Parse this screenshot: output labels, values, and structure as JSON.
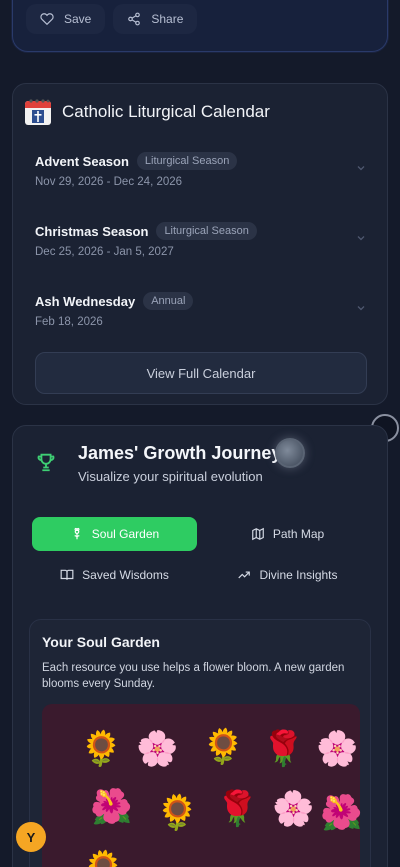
{
  "top_actions": {
    "save_label": "Save",
    "share_label": "Share"
  },
  "liturgical": {
    "title": "Catholic Liturgical Calendar",
    "items": [
      {
        "name": "Advent Season",
        "badge": "Liturgical Season",
        "date": "Nov 29, 2026 - Dec 24, 2026"
      },
      {
        "name": "Christmas Season",
        "badge": "Liturgical Season",
        "date": "Dec 25, 2026 - Jan 5, 2027"
      },
      {
        "name": "Ash Wednesday",
        "badge": "Annual",
        "date": "Feb 18, 2026"
      }
    ],
    "view_label": "View Full Calendar"
  },
  "growth": {
    "title": "James' Growth Journey",
    "subtitle": "Visualize your spiritual evolution",
    "tabs": [
      {
        "label": "Soul Garden",
        "icon": "flower-icon",
        "active": true
      },
      {
        "label": "Path Map",
        "icon": "map-icon",
        "active": false
      },
      {
        "label": "Saved Wisdoms",
        "icon": "book-icon",
        "active": false
      },
      {
        "label": "Divine Insights",
        "icon": "trending-up-icon",
        "active": false
      }
    ],
    "garden": {
      "title": "Your Soul Garden",
      "description": "Each resource you use helps a flower bloom. A new garden blooms every Sunday.",
      "flowers": [
        "🌻",
        "🌸",
        "🌻",
        "🌹",
        "🌸",
        "🌺",
        "🌻",
        "🌹",
        "🌸",
        "🌺",
        "🌻"
      ]
    }
  },
  "floating_badge": {
    "label": "Y"
  },
  "colors": {
    "accent_green": "#2ecc62",
    "badge_orange": "#f5a623",
    "background": "#141a2a"
  }
}
